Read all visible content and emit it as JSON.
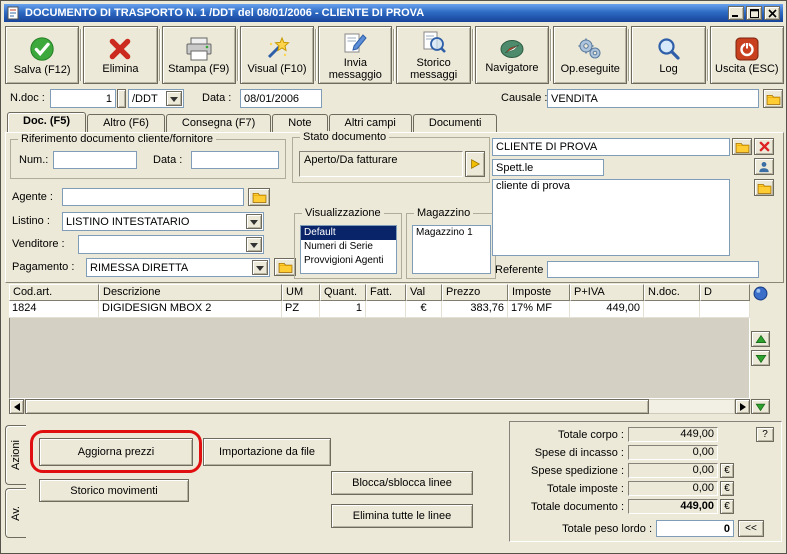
{
  "window": {
    "title": "DOCUMENTO DI TRASPORTO N. 1 /DDT del 08/01/2006 - CLIENTE DI PROVA"
  },
  "toolbar": [
    {
      "label": "Salva (F12)",
      "icon": "check-circle"
    },
    {
      "label": "Elimina",
      "icon": "red-x"
    },
    {
      "label": "Stampa (F9)",
      "icon": "printer"
    },
    {
      "label": "Visual (F10)",
      "icon": "magic-wand"
    },
    {
      "label": "Invia messaggio",
      "icon": "compose"
    },
    {
      "label": "Storico messaggi",
      "icon": "doc-magnifier"
    },
    {
      "label": "Navigatore",
      "icon": "compass"
    },
    {
      "label": "Op.eseguite",
      "icon": "gears"
    },
    {
      "label": "Log",
      "icon": "magnifier"
    },
    {
      "label": "Uscita (ESC)",
      "icon": "power"
    }
  ],
  "header": {
    "ndoc_label": "N.doc :",
    "ndoc_value": "1",
    "doc_type": "/DDT",
    "date_label": "Data :",
    "date_value": "08/01/2006",
    "causale_label": "Causale :",
    "causale_value": "VENDITA"
  },
  "tabs": [
    "Doc. (F5)",
    "Altro (F6)",
    "Consegna (F7)",
    "Note",
    "Altri campi",
    "Documenti"
  ],
  "form": {
    "rif_group": "Riferimento documento cliente/fornitore",
    "num_label": "Num.:",
    "num_value": "",
    "data_label": "Data :",
    "data_value": "",
    "stato_group": "Stato documento",
    "stato_value": "Aperto/Da fatturare",
    "agente_label": "Agente :",
    "agente_value": "",
    "listino_label": "Listino :",
    "listino_value": "LISTINO INTESTATARIO",
    "venditore_label": "Venditore :",
    "venditore_value": "",
    "pagamento_label": "Pagamento :",
    "pagamento_value": "RIMESSA DIRETTA",
    "visualizzazione_group": "Visualizzazione",
    "visualizzazione_items": [
      "Default",
      "Numeri di Serie",
      "Provvigioni Agenti"
    ],
    "magazzino_group": "Magazzino",
    "magazzino_items": [
      "Magazzino 1"
    ],
    "cliente_value": "CLIENTE DI PROVA",
    "spettle_value": "Spett.le",
    "cliente_note": "cliente di prova",
    "referente_label": "Referente",
    "referente_value": ""
  },
  "grid": {
    "columns": [
      "Cod.art.",
      "Descrizione",
      "UM",
      "Quant.",
      "Fatt.",
      "Val",
      "Prezzo",
      "Imposte",
      "P+IVA",
      "N.doc.",
      "D"
    ],
    "rows": [
      [
        "1824",
        "DIGIDESIGN MBOX 2",
        "PZ",
        "1",
        "",
        "€",
        "383,76",
        "17% MF",
        "449,00",
        "",
        ""
      ]
    ]
  },
  "actions": {
    "tab_azioni": "Azioni",
    "tab_av": "Av.",
    "aggiorna_prezzi": "Aggiorna prezzi",
    "importazione_da_file": "Importazione da file",
    "storico_movimenti": "Storico movimenti",
    "blocca_sblocca": "Blocca/sblocca linee",
    "elimina_tutte": "Elimina tutte le linee"
  },
  "totals": {
    "corpo_label": "Totale corpo :",
    "corpo_value": "449,00",
    "help_button": "?",
    "incasso_label": "Spese di incasso :",
    "incasso_value": "0,00",
    "spedizione_label": "Spese spedizione :",
    "spedizione_value": "0,00",
    "imposte_label": "Totale imposte :",
    "imposte_value": "0,00",
    "documento_label": "Totale documento :",
    "documento_value": "449,00",
    "euro_button": "€",
    "peso_label": "Totale peso lordo :",
    "peso_value": "0",
    "collapse_button": "<<"
  },
  "colors": {
    "titlebar_blue": "#2E6BC4",
    "selection_navy": "#0A246A",
    "window_gray": "#ECE9D8",
    "annotation_red": "#E01010"
  }
}
